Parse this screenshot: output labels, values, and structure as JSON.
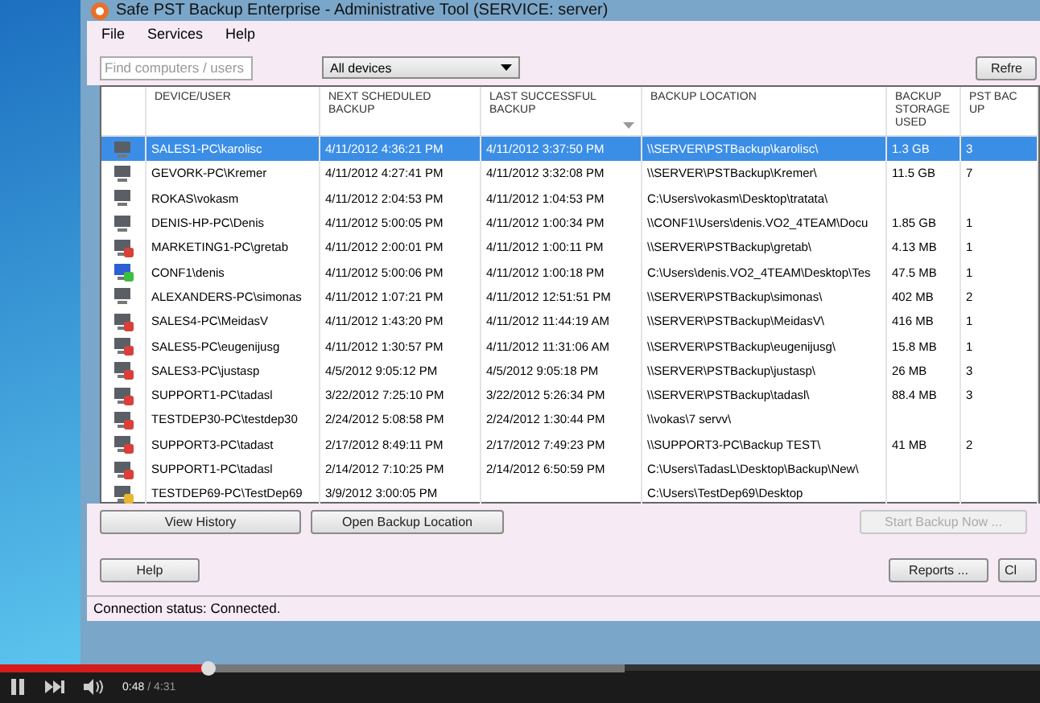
{
  "window": {
    "title": "Safe PST Backup Enterprise - Administrative Tool (SERVICE: server)"
  },
  "menu": [
    "File",
    "Services",
    "Help"
  ],
  "toolbar": {
    "search": {
      "placeholder": "Find computers / users"
    },
    "filter": {
      "value": "All devices"
    },
    "refresh_button": "Refre"
  },
  "table": {
    "columns": [
      {
        "label": "DEVICE/USER",
        "sorted": false
      },
      {
        "label": "NEXT SCHEDULED BACKUP",
        "sorted": false
      },
      {
        "label": "LAST SUCCESSFUL BACKUP",
        "sorted": true
      },
      {
        "label": "BACKUP LOCATION",
        "sorted": false
      },
      {
        "label": "BACKUP STORAGE USED",
        "sorted": false
      },
      {
        "label": "PST BAC UP",
        "sorted": false
      }
    ],
    "rows": [
      {
        "kind": "ok",
        "selected": true,
        "device": "SALES1-PC\\karolisc",
        "next": "4/11/2012 4:36:21 PM",
        "last": "4/11/2012 3:37:50 PM",
        "location": "\\\\SERVER\\PSTBackup\\karolisc\\",
        "storage": "1.3 GB",
        "pst": "3"
      },
      {
        "kind": "ok",
        "selected": false,
        "device": "GEVORK-PC\\Kremer",
        "next": "4/11/2012 4:27:41 PM",
        "last": "4/11/2012 3:32:08 PM",
        "location": "\\\\SERVER\\PSTBackup\\Kremer\\",
        "storage": "11.5 GB",
        "pst": "7"
      },
      {
        "kind": "ok",
        "selected": false,
        "device": "ROKAS\\vokasm",
        "next": "4/11/2012 2:04:53 PM",
        "last": "4/11/2012 1:04:53 PM",
        "location": "C:\\Users\\vokasm\\Desktop\\tratata\\"
      },
      {
        "kind": "ok",
        "selected": false,
        "device": "DENIS-HP-PC\\Denis",
        "next": "4/11/2012 5:00:05 PM",
        "last": "4/11/2012 1:00:34 PM",
        "location": "\\\\CONF1\\Users\\denis.VO2_4TEAM\\Docu",
        "storage": "1.85 GB",
        "pst": "1"
      },
      {
        "kind": "error",
        "selected": false,
        "device": "MARKETING1-PC\\gretab",
        "next": "4/11/2012 2:00:01 PM",
        "last": "4/11/2012 1:00:11 PM",
        "location": "\\\\SERVER\\PSTBackup\\gretab\\",
        "storage": "4.13 MB",
        "pst": "1"
      },
      {
        "kind": "online",
        "selected": false,
        "device": "CONF1\\denis",
        "next": "4/11/2012 5:00:06 PM",
        "last": "4/11/2012 1:00:18 PM",
        "location": "C:\\Users\\denis.VO2_4TEAM\\Desktop\\Tes",
        "storage": "47.5 MB",
        "pst": "1"
      },
      {
        "kind": "ok",
        "selected": false,
        "device": "ALEXANDERS-PC\\simonas",
        "next": "4/11/2012 1:07:21 PM",
        "last": "4/11/2012 12:51:51 PM",
        "location": "\\\\SERVER\\PSTBackup\\simonas\\",
        "storage": "402 MB",
        "pst": "2"
      },
      {
        "kind": "error",
        "selected": false,
        "device": "SALES4-PC\\MeidasV",
        "next": "4/11/2012 1:43:20 PM",
        "last": "4/11/2012 11:44:19 AM",
        "location": "\\\\SERVER\\PSTBackup\\MeidasV\\",
        "storage": "416 MB",
        "pst": "1"
      },
      {
        "kind": "error",
        "selected": false,
        "device": "SALES5-PC\\eugenijusg",
        "next": "4/11/2012 1:30:57 PM",
        "last": "4/11/2012 11:31:06 AM",
        "location": "\\\\SERVER\\PSTBackup\\eugenijusg\\",
        "storage": "15.8 MB",
        "pst": "1"
      },
      {
        "kind": "error",
        "selected": false,
        "device": "SALES3-PC\\justasp",
        "next": "4/5/2012 9:05:12 PM",
        "last": "4/5/2012 9:05:18 PM",
        "location": "\\\\SERVER\\PSTBackup\\justasp\\",
        "storage": "26 MB",
        "pst": "3"
      },
      {
        "kind": "error",
        "selected": false,
        "device": "SUPPORT1-PC\\tadasl",
        "next": "3/22/2012 7:25:10 PM",
        "last": "3/22/2012 5:26:34 PM",
        "location": "\\\\SERVER\\PSTBackup\\tadasl\\",
        "storage": "88.4 MB",
        "pst": "3"
      },
      {
        "kind": "error",
        "selected": false,
        "device": "TESTDEP30-PC\\testdep30",
        "next": "2/24/2012 5:08:58 PM",
        "last": "2/24/2012 1:30:44 PM",
        "location": "\\\\vokas\\7 servv\\"
      },
      {
        "kind": "error",
        "selected": false,
        "device": "SUPPORT3-PC\\tadast",
        "next": "2/17/2012 8:49:11 PM",
        "last": "2/17/2012 7:49:23 PM",
        "location": "\\\\SUPPORT3-PC\\Backup TEST\\",
        "storage": "41 MB",
        "pst": "2"
      },
      {
        "kind": "error",
        "selected": false,
        "device": "SUPPORT1-PC\\tadasl",
        "next": "2/14/2012 7:10:25 PM",
        "last": "2/14/2012 6:50:59 PM",
        "location": "C:\\Users\\TadasL\\Desktop\\Backup\\New\\"
      },
      {
        "kind": "warning",
        "selected": false,
        "device": "TESTDEP69-PC\\TestDep69",
        "next": "3/9/2012 3:00:05 PM",
        "location": "C:\\Users\\TestDep69\\Desktop"
      }
    ]
  },
  "actions": [
    {
      "label": "View History",
      "disabled": false
    },
    {
      "label": "Open Backup Location",
      "disabled": false
    },
    {
      "label": "Start Backup Now ...",
      "disabled": true
    }
  ],
  "footer_buttons": [
    "Help",
    "Reports ...",
    "Cl"
  ],
  "status_bar": "Connection status: Connected.",
  "player": {
    "level": 0.2,
    "elapsed": "0:48",
    "duration": "/ 4:31"
  }
}
